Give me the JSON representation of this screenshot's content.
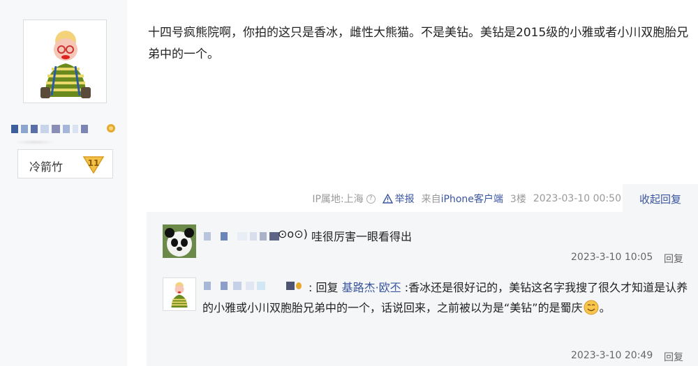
{
  "post": {
    "author_fan_label": "冷箭竹",
    "author_fan_level": "11",
    "content": "十四号疯熊院啊，你拍的这只是香冰，雌性大熊猫。不是美钻。美钻是2015级的小雅或者小川双胞胎兄弟中的一个。",
    "meta": {
      "ip": "IP属地:上海",
      "report": "举报",
      "source_prefix": "来自",
      "source": "iPhone客户端",
      "floor": "3楼",
      "time": "2023-03-10 00:50",
      "collapse": "收起回复"
    }
  },
  "replies": [
    {
      "name_suffix": "⊙o⊙)",
      "text": "哇很厉害一眼看得出",
      "time": "2023-3-10 10:05",
      "reply_label": "回复"
    },
    {
      "prefix": ": 回复 ",
      "mention": "基路杰·欧丕",
      "text_1": " :香冰还是很好记的，美钻这名字我搜了很久才知道是认养的小雅或小川双胞胎兄弟中的一个，话说回来，之前被以为是“美钻”的是蜀庆",
      "text_2": "。",
      "time": "2023-3-10 20:49",
      "reply_label": "回复"
    }
  ],
  "colors": {
    "link": "#3a55a0",
    "sidebar_bg": "#f7f8fa",
    "reply_bg": "#f5f6f8"
  },
  "icons": [
    "author-avatar",
    "fan-level-badge",
    "help-circle-icon",
    "warning-icon",
    "panda-avatar-icon",
    "smile-emoji-icon"
  ]
}
